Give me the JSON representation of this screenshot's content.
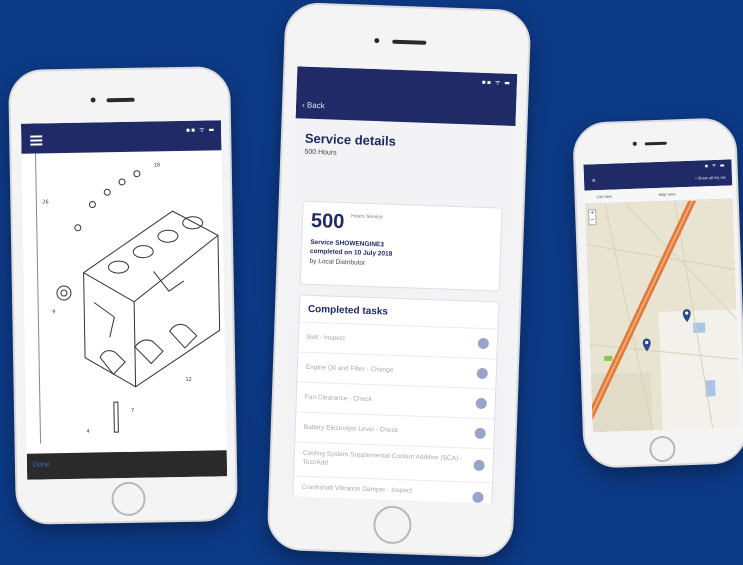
{
  "left_phone": {
    "status_icons": "▪▪ ᯤ ▬",
    "bottom_label": "Done",
    "drawing": "exploded-view engine block parts drawing"
  },
  "center_phone": {
    "status_icons": "▪▪ ᯤ ▬",
    "back_label": "‹ Back",
    "title": "Service details",
    "hours": "500 Hours",
    "summary": {
      "number": "500",
      "unit": "Hours Service",
      "line1": "Service SHOWENGINE3",
      "line2": "completed on 10 July 2018",
      "by": "by Local Distributor"
    },
    "tasks_title": "Completed tasks",
    "tasks": [
      "Belt - Inspect",
      "Engine Oil and Filter - Change",
      "Fan Clearance - Check",
      "Battery Electrolyte Level - Check",
      "Cooling System Supplemental Coolant Additive (SCA) - Test/Add",
      "Crankshaft Vibration Damper - Inspect"
    ]
  },
  "right_phone": {
    "status_icons": "▪ ᯤ ▬",
    "nav_icon": "≡",
    "nav_right": "• Show all my rec",
    "toolbar_left": "List view",
    "toolbar_right": "Map view",
    "zoom_in": "+",
    "zoom_out": "−",
    "colors": {
      "road": "#e07a3c",
      "land": "#e9e4d2",
      "marker": "#2d4b8a"
    }
  },
  "colors": {
    "background": "#0d3a87",
    "navbar": "#1f2a66",
    "accent": "#1f2a66"
  }
}
